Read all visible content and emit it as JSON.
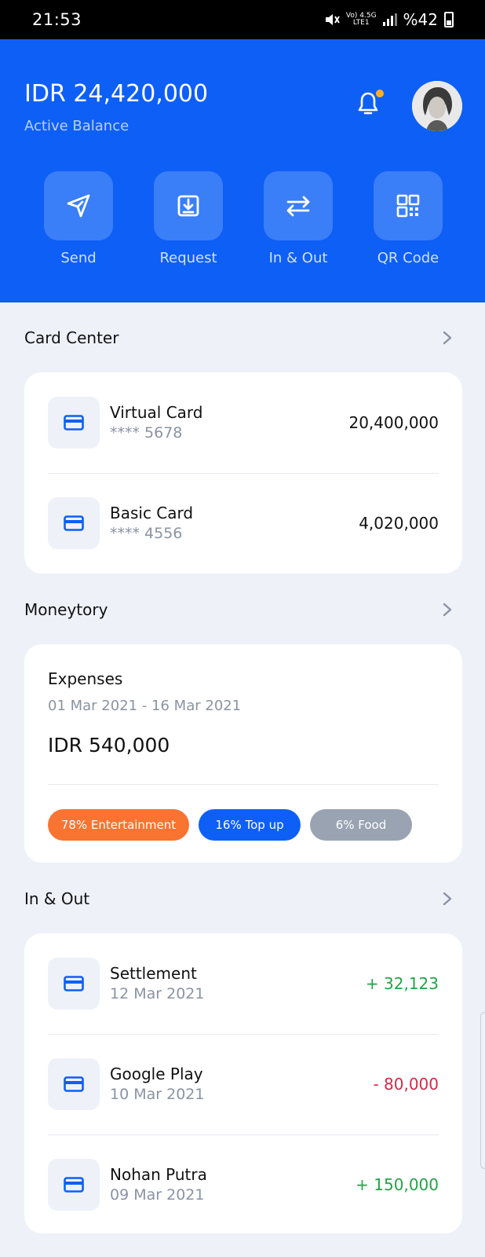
{
  "status_bar": {
    "time": "21:53",
    "network_top": "Vo) 4.5G",
    "network_bottom": "LTE1",
    "battery": "%42"
  },
  "header": {
    "balance": "IDR 24,420,000",
    "balance_label": "Active Balance",
    "actions": [
      {
        "label": "Send",
        "icon": "send-icon"
      },
      {
        "label": "Request",
        "icon": "download-icon"
      },
      {
        "label": "In & Out",
        "icon": "transfer-icon"
      },
      {
        "label": "QR Code",
        "icon": "qr-code-icon"
      }
    ]
  },
  "card_center": {
    "title": "Card Center",
    "cards": [
      {
        "name": "Virtual Card",
        "number": "**** 5678",
        "amount": "20,400,000"
      },
      {
        "name": "Basic Card",
        "number": "**** 4556",
        "amount": "4,020,000"
      }
    ]
  },
  "moneytory": {
    "title": "Moneytory",
    "expenses_label": "Expenses",
    "date_range": "01 Mar 2021 - 16 Mar 2021",
    "amount": "IDR 540,000",
    "pills": [
      {
        "label": "78% Entertainment",
        "color": "#f97331"
      },
      {
        "label": "16% Top up",
        "color": "#0e5ff6"
      },
      {
        "label": "6% Food",
        "color": "#9aa3b2"
      }
    ]
  },
  "in_out": {
    "title": "In & Out",
    "transactions": [
      {
        "name": "Settlement",
        "date": "12 Mar 2021",
        "amount": "+ 32,123",
        "type": "in"
      },
      {
        "name": "Google Play",
        "date": "10 Mar 2021",
        "amount": "- 80,000",
        "type": "out"
      },
      {
        "name": "Nohan Putra",
        "date": "09 Mar 2021",
        "amount": "+ 150,000",
        "type": "in"
      }
    ]
  },
  "colors": {
    "primary": "#0e5ff6",
    "positive": "#22a447",
    "negative": "#d22a4a",
    "background": "#eef1f8"
  }
}
